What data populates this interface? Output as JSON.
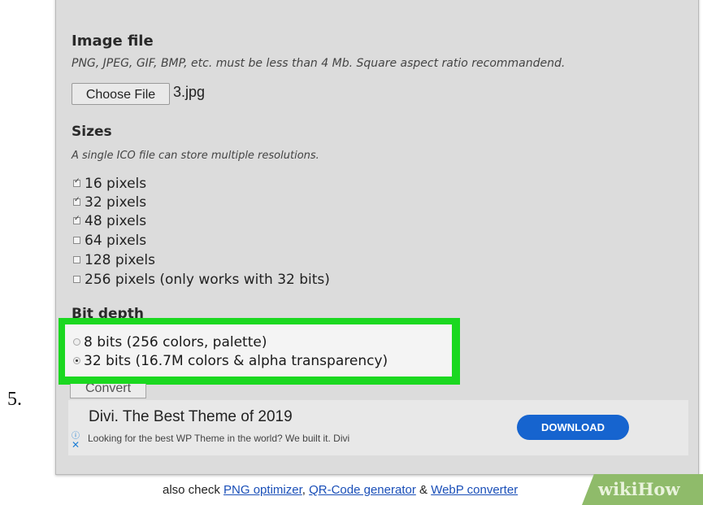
{
  "step_number": "5.",
  "image_file": {
    "heading": "Image file",
    "description": "PNG, JPEG, GIF, BMP, etc. must be less than 4 Mb. Square aspect ratio recommandend.",
    "choose_button": "Choose File",
    "filename": "3.jpg"
  },
  "sizes": {
    "heading": "Sizes",
    "description": "A single ICO file can store multiple resolutions.",
    "options": [
      {
        "label": "16 pixels",
        "checked": true
      },
      {
        "label": "32 pixels",
        "checked": true
      },
      {
        "label": "48 pixels",
        "checked": true
      },
      {
        "label": "64 pixels",
        "checked": false
      },
      {
        "label": "128 pixels",
        "checked": false
      },
      {
        "label": "256 pixels (only works with 32 bits)",
        "checked": false
      }
    ]
  },
  "bit_depth": {
    "heading": "Bit depth",
    "options": [
      {
        "label": "8 bits (256 colors, palette)",
        "selected": false
      },
      {
        "label": "32 bits (16.7M colors & alpha transparency)",
        "selected": true
      }
    ],
    "highlight_color": "#1bd820"
  },
  "convert_button": "Convert",
  "ad": {
    "title": "Divi. The Best Theme of 2019",
    "description": "Looking for the best WP Theme in the world? We built it. Divi",
    "info_icon": "info-icon",
    "close_icon": "close-icon",
    "download_button": "DOWNLOAD",
    "button_color": "#1664cf"
  },
  "footer": {
    "prefix": "also check",
    "link1": "PNG optimizer",
    "sep1": ",",
    "link2": "QR-Code generator",
    "sep2": "&",
    "link3": "WebP converter"
  },
  "watermark": {
    "part1": "wiki",
    "part2": "How"
  }
}
